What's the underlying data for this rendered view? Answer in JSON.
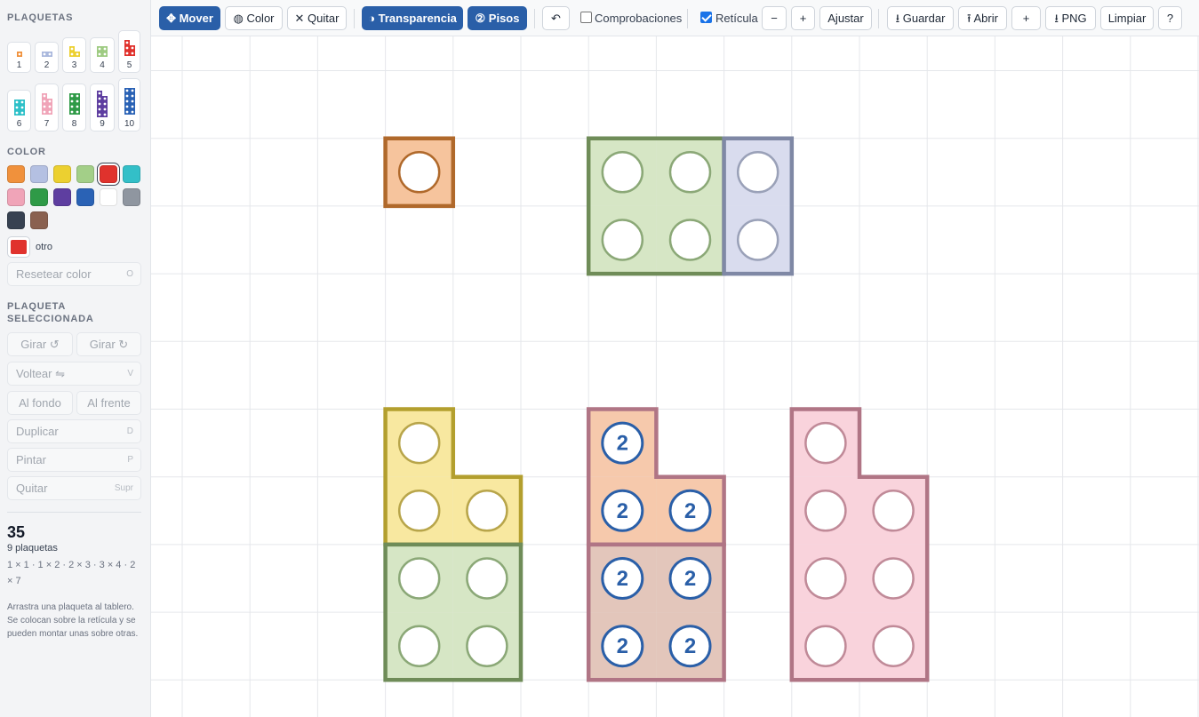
{
  "sidebar": {
    "plaquetas_label": "PLAQUETAS",
    "pieces": [
      {
        "label": "1",
        "color": "#f0913c"
      },
      {
        "label": "2",
        "color": "#aab8dd"
      },
      {
        "label": "3",
        "color": "#ecd030"
      },
      {
        "label": "4",
        "color": "#9ecb82"
      },
      {
        "label": "5",
        "color": "#e0322d"
      },
      {
        "label": "6",
        "color": "#2ec0c8"
      },
      {
        "label": "7",
        "color": "#f0a4b8"
      },
      {
        "label": "8",
        "color": "#2f9a47"
      },
      {
        "label": "9",
        "color": "#5e3ea0"
      },
      {
        "label": "10",
        "color": "#2a62b5"
      }
    ],
    "color_label": "COLOR",
    "swatches": [
      {
        "name": "orange",
        "color": "#f0913c"
      },
      {
        "name": "light-blue",
        "color": "#b4c0e2"
      },
      {
        "name": "yellow",
        "color": "#ecd030"
      },
      {
        "name": "light-green",
        "color": "#a3cf88"
      },
      {
        "name": "red",
        "color": "#e0322d",
        "selected": true
      },
      {
        "name": "cyan",
        "color": "#33bfc8"
      },
      {
        "name": "pink",
        "color": "#f0a4b8"
      },
      {
        "name": "green",
        "color": "#2f9a47"
      },
      {
        "name": "purple",
        "color": "#5e3ea0"
      },
      {
        "name": "blue",
        "color": "#2a62b5"
      },
      {
        "name": "white",
        "color": "#ffffff"
      },
      {
        "name": "gray",
        "color": "#8f96a0"
      },
      {
        "name": "charcoal",
        "color": "#374151"
      },
      {
        "name": "brown",
        "color": "#8a6150"
      }
    ],
    "otro_label": "otro",
    "otro_color": "#e0322d",
    "reset_color": {
      "label": "Resetear color",
      "key": "O"
    },
    "selected_label": "PLAQUETA SELECCIONADA",
    "actions": {
      "rotate_left": "Girar ↺",
      "rotate_right": "Girar ↻",
      "flip": {
        "label": "Voltear ⇋",
        "key": "V"
      },
      "to_back": "Al fondo",
      "to_front": "Al frente",
      "duplicate": {
        "label": "Duplicar",
        "key": "D"
      },
      "paint": {
        "label": "Pintar",
        "key": "P"
      },
      "remove": {
        "label": "Quitar",
        "key": "Supr"
      }
    },
    "total": "35",
    "pieces_count": "9 plaquetas",
    "sizes": "1 × 1 · 1 × 2 · 2 × 3 · 3 × 4 · 2 × 7",
    "help": "Arrastra una plaqueta al tablero. Se colocan sobre la retícula y se pueden montar unas sobre otras."
  },
  "toolbar": {
    "move": "✥ Mover",
    "color": "◍ Color",
    "remove": "✕ Quitar",
    "transparency": "◑ Transparencia",
    "floors": "② Pisos",
    "undo": "↶",
    "checks_label": "Comprobaciones",
    "checks_on": false,
    "grid_label": "Retícula",
    "grid_on": true,
    "zoom_out": "−",
    "zoom_in": "+",
    "fit": "Ajustar",
    "save": "⭳ Guardar",
    "open": "⭱ Abrir",
    "add": "+",
    "png": "⭳ PNG",
    "clear": "Limpiar",
    "help": "?"
  },
  "board": {
    "grid_color": "#e5e7eb",
    "tiles": [
      {
        "name": "piece-1x1-orange",
        "cells": [
          [
            3,
            1
          ]
        ],
        "fill": "#f6c49d",
        "stroke": "#b0692b",
        "hole_stroke": "#b0692b",
        "level": ""
      },
      {
        "name": "piece-2x2-green",
        "cells": [
          [
            6,
            1
          ],
          [
            7,
            1
          ],
          [
            6,
            2
          ],
          [
            7,
            2
          ]
        ],
        "fill": "#d6e6c5",
        "stroke": "#6f8c58",
        "hole_stroke": "#8ba877",
        "level": ""
      },
      {
        "name": "piece-1x2-blue",
        "cells": [
          [
            8,
            1
          ],
          [
            8,
            2
          ]
        ],
        "fill": "#d9dcee",
        "stroke": "#7f88a5",
        "hole_stroke": "#9aa1b8",
        "level": ""
      },
      {
        "name": "piece-3-yellow",
        "cells": [
          [
            3,
            5
          ],
          [
            3,
            6
          ],
          [
            4,
            6
          ]
        ],
        "fill": "#f8e8a0",
        "stroke": "#b39f2e",
        "hole_stroke": "#b8a54a",
        "level": ""
      },
      {
        "name": "piece-2x2-green-lower",
        "cells": [
          [
            3,
            7
          ],
          [
            4,
            7
          ],
          [
            3,
            8
          ],
          [
            4,
            8
          ]
        ],
        "fill": "#d6e6c5",
        "stroke": "#6f8c58",
        "hole_stroke": "#8ba877",
        "level": ""
      },
      {
        "name": "piece-3-orange-floor2",
        "cells": [
          [
            6,
            5
          ],
          [
            6,
            6
          ],
          [
            7,
            6
          ]
        ],
        "fill": "#f6c9ac",
        "stroke": "#b07585",
        "hole_stroke": "#2a5fa8",
        "level": "2"
      },
      {
        "name": "piece-2x2-brown-floor2",
        "cells": [
          [
            6,
            7
          ],
          [
            7,
            7
          ],
          [
            6,
            8
          ],
          [
            7,
            8
          ]
        ],
        "fill": "#e3c6bb",
        "stroke": "#b07585",
        "hole_stroke": "#2a5fa8",
        "level": "2"
      },
      {
        "name": "piece-7-pink",
        "cells": [
          [
            9,
            5
          ],
          [
            9,
            6
          ],
          [
            10,
            6
          ],
          [
            9,
            7
          ],
          [
            10,
            7
          ],
          [
            9,
            8
          ],
          [
            10,
            8
          ]
        ],
        "fill": "#f9d3dc",
        "stroke": "#b07585",
        "hole_stroke": "#c08a98",
        "level": ""
      }
    ]
  }
}
